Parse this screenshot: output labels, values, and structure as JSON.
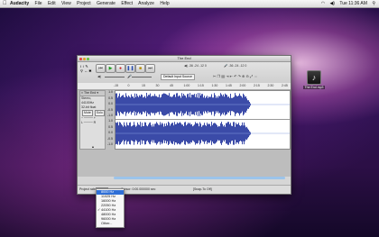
{
  "menubar": {
    "apple": "",
    "app_name": "Audacity",
    "menus": [
      "File",
      "Edit",
      "View",
      "Project",
      "Generate",
      "Effect",
      "Analyze",
      "Help"
    ],
    "clock": "Tue 11:36 AM"
  },
  "desktop_icon": {
    "label": "The End.mp3"
  },
  "window": {
    "title": "The End",
    "meter_left": "-36  -24  -12   0",
    "meter_right": "-36  -24  -12   0",
    "input_device": "Default Input Source",
    "ruler": [
      "-15",
      "0",
      "15",
      "30",
      "45",
      "1:00",
      "1:15",
      "1:30",
      "1:45",
      "2:00",
      "2:15",
      "2:30",
      "2:45"
    ],
    "track": {
      "name": "The End",
      "info1": "Stereo, 44100Hz",
      "info2": "32-bit float",
      "mute": "Mute",
      "solo": "Solo",
      "scale_top": [
        "1.0",
        "0.5",
        "0.0",
        "-0.5",
        "-1.0"
      ],
      "scale_bottom": [
        "1.0",
        "0.5",
        "0.0",
        "-0.5",
        "-1.0"
      ]
    },
    "status": {
      "rate_label": "Project rate:",
      "rate_value": "44100",
      "cursor": "Cursor: 0:00.000000 sec",
      "snap": "[Snap-To Off]"
    }
  },
  "dropdown": {
    "options": [
      "8000 Hz",
      "11025 Hz",
      "16000 Hz",
      "22050 Hz",
      "44100 Hz",
      "48000 Hz",
      "96000 Hz",
      "Other..."
    ],
    "highlighted": "8000 Hz",
    "checked": "44100 Hz"
  },
  "colors": {
    "waveform": "#3b4ba8",
    "selection": "#2f6fd6"
  }
}
